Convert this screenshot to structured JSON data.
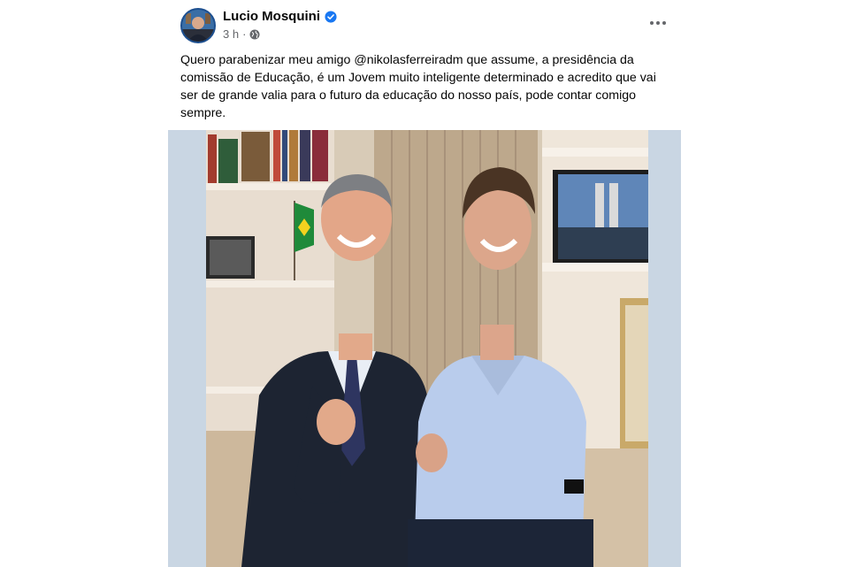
{
  "post": {
    "author": "Lucio Mosquini",
    "time": "3 h",
    "separator": "·",
    "body": "Quero parabenizar meu amigo @nikolasferreiradm que assume, a presidência da comissão de Educação, é um Jovem muito inteligente determinado e acredito que vai ser de grande valia para o futuro da educação do nosso país, pode contar comigo sempre.",
    "icons": {
      "verified": "verified-badge-icon",
      "audience": "globe-icon",
      "menu": "more-options-icon"
    },
    "colors": {
      "verified": "#1877f2",
      "meta": "#65676b",
      "media_background": "#c9d6e3"
    }
  }
}
